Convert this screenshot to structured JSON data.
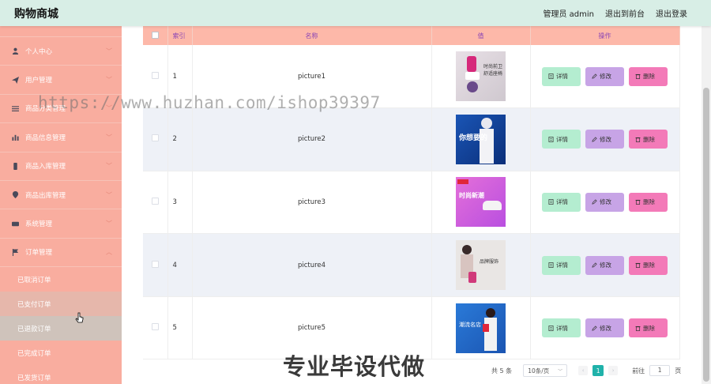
{
  "header": {
    "brand": "购物商城",
    "admin_label": "管理员 admin",
    "front_link": "退出到前台",
    "logout_link": "退出登录"
  },
  "sidebar": {
    "items": [
      {
        "label": "个人中心",
        "icon": "user-icon"
      },
      {
        "label": "用户管理",
        "icon": "send-icon"
      },
      {
        "label": "商品分类管理",
        "icon": "sliders-icon"
      },
      {
        "label": "商品信息管理",
        "icon": "bar-chart-icon"
      },
      {
        "label": "商品入库管理",
        "icon": "phone-icon"
      },
      {
        "label": "商品出库管理",
        "icon": "location-icon"
      },
      {
        "label": "系统管理",
        "icon": "ticket-icon"
      },
      {
        "label": "订单管理",
        "icon": "flag-icon"
      }
    ],
    "sub_items": [
      "已取消订单",
      "已支付订单",
      "已退款订单",
      "已完成订单",
      "已发货订单"
    ]
  },
  "table": {
    "headers": {
      "index": "索引",
      "name": "名称",
      "value": "值",
      "ops": "操作"
    },
    "rows": [
      {
        "index": "1",
        "name": "picture1"
      },
      {
        "index": "2",
        "name": "picture2"
      },
      {
        "index": "3",
        "name": "picture3"
      },
      {
        "index": "4",
        "name": "picture4"
      },
      {
        "index": "5",
        "name": "picture5"
      }
    ],
    "buttons": {
      "detail": "详情",
      "edit": "修改",
      "delete": "删除"
    }
  },
  "pagination": {
    "total": "共 5 条",
    "page_size": "10条/页",
    "current_page": "1",
    "goto_label": "前往",
    "goto_value": "1",
    "page_unit": "页"
  },
  "watermark": {
    "url": "https://www.huzhan.com/ishop39397",
    "text": "专业毕设代做"
  },
  "thumb_texts": {
    "t1": "时尚前卫舒适座椅",
    "t2": "你想要的",
    "t3": "时尚新潮",
    "t4": "品牌服饰",
    "t5": "潮流名店"
  },
  "colors": {
    "header_bg": "#d8eee6",
    "sidebar_bg": "#f9ad9f",
    "table_header_bg": "#fdb8a9",
    "detail_btn": "#b4edd0",
    "edit_btn": "#c7a4e6",
    "delete_btn": "#f37ab8",
    "pager_active": "#20b2aa"
  }
}
